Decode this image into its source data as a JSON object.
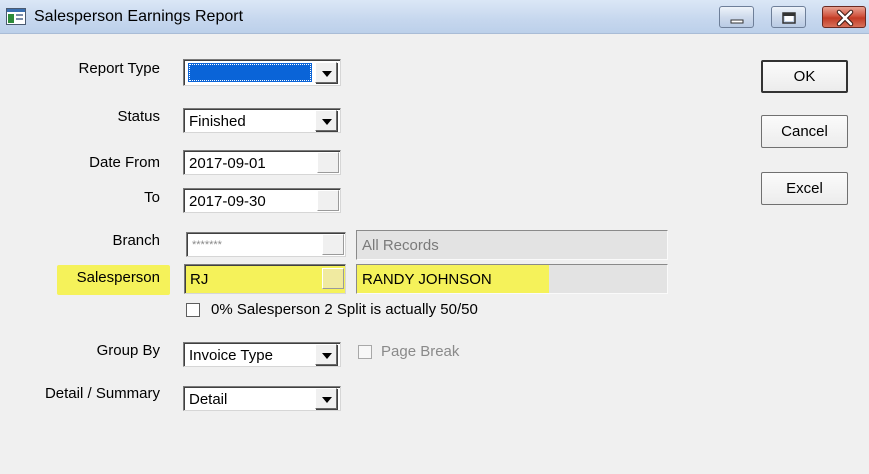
{
  "window": {
    "title": "Salesperson Earnings Report"
  },
  "form": {
    "report_type": {
      "label": "Report Type",
      "value": ""
    },
    "status": {
      "label": "Status",
      "value": "Finished"
    },
    "date_from": {
      "label": "Date From",
      "value": "2017-09-01"
    },
    "date_to": {
      "label": "To",
      "value": "2017-09-30"
    },
    "branch": {
      "label": "Branch",
      "value": "*******",
      "description": "All Records"
    },
    "salesperson": {
      "label": "Salesperson",
      "value": "RJ",
      "description": "RANDY JOHNSON"
    },
    "split_checkbox": {
      "label": "0% Salesperson 2 Split is actually 50/50",
      "checked": false
    },
    "group_by": {
      "label": "Group By",
      "value": "Invoice Type"
    },
    "page_break": {
      "label": "Page Break",
      "checked": false,
      "enabled": false
    },
    "detail_summary": {
      "label": "Detail / Summary",
      "value": "Detail"
    }
  },
  "buttons": {
    "ok": "OK",
    "cancel": "Cancel",
    "excel": "Excel"
  },
  "colors": {
    "selection_blue": "#0a64d8",
    "highlight_yellow": "#f5f25a"
  },
  "icons": [
    "app-icon",
    "minimize-icon",
    "maximize-icon",
    "close-icon",
    "dropdown-arrow-icon"
  ]
}
